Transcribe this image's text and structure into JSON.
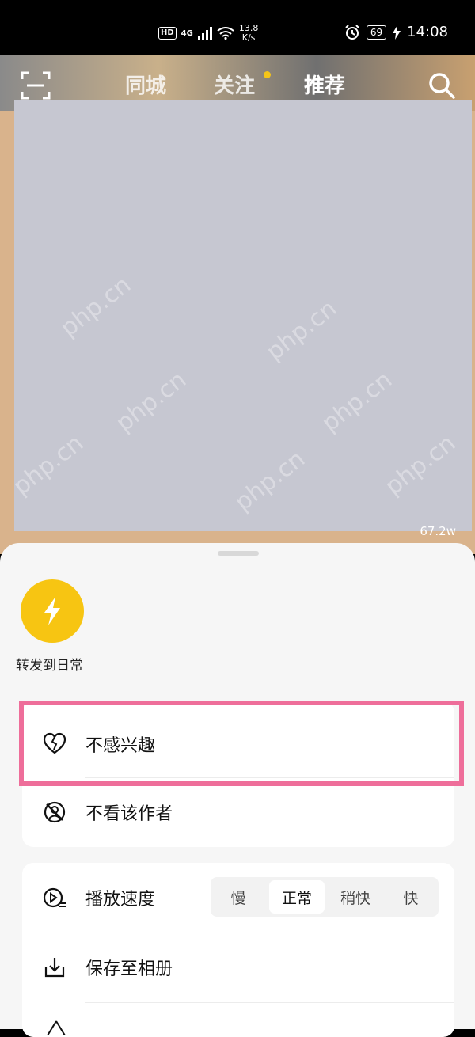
{
  "status_bar": {
    "hd": "HD",
    "net_type": "4G",
    "speed_value": "13.8",
    "speed_unit": "K/s",
    "battery": "69",
    "time": "14:08"
  },
  "top_nav": {
    "tabs": [
      {
        "label": "同城"
      },
      {
        "label": "关注"
      },
      {
        "label": "推荐"
      }
    ]
  },
  "video": {
    "views": "67.2w",
    "watermark": "php.cn"
  },
  "sheet": {
    "share_label": "转发到日常",
    "menu1": [
      {
        "label": "不感兴趣",
        "icon": "broken-heart-icon"
      },
      {
        "label": "不看该作者",
        "icon": "block-author-icon"
      }
    ],
    "speed": {
      "label": "播放速度",
      "options": [
        "慢",
        "正常",
        "稍快",
        "快"
      ],
      "selected": "正常"
    },
    "save_label": "保存至相册"
  },
  "colors": {
    "accent_yellow": "#f7c512",
    "highlight": "#ee6e9a"
  }
}
